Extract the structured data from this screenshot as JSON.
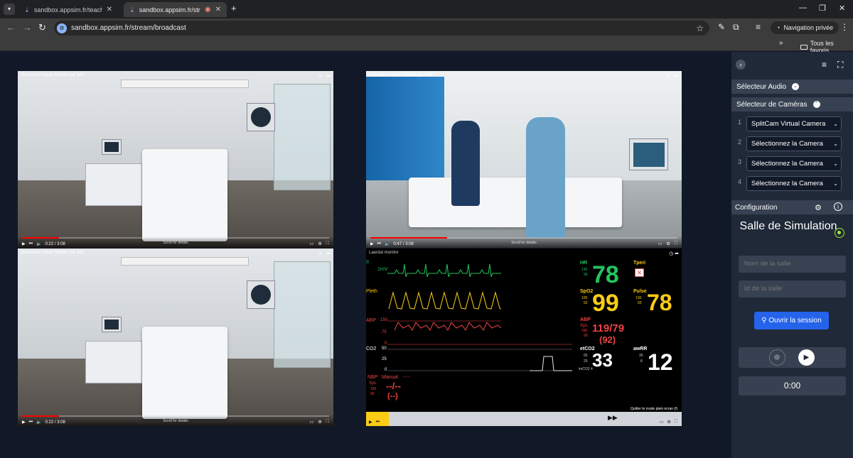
{
  "browser": {
    "tabs": [
      {
        "title": "sandbox.appsim.fr/teacher/tea",
        "active": false
      },
      {
        "title": "sandbox.appsim.fr/stream/b",
        "active": true
      }
    ],
    "url": "sandbox.appsim.fr/stream/broadcast",
    "private_label": "Navigation privée",
    "bookmarks_label": "Tous les favoris"
  },
  "videos": {
    "top_left": {
      "title": "Simulation Haute Fidélité par IMS",
      "time": "0:22 / 3:08",
      "scroll": "Scroll for details"
    },
    "top_right": {
      "title": "Simulation Haute Fidélité par IMS",
      "time": "0:47 / 3:08",
      "scroll": "Scroll for details"
    },
    "bottom_left": {
      "title": "Simulation Haute Fidélité par IMS",
      "time": "0:22 / 3:08",
      "scroll": "Scroll for details"
    },
    "monitor": {
      "title": "Laerdal monitor",
      "exit_fullscreen": "Quitter le mode plein écran (f)",
      "ecg": {
        "label": "II",
        "scale": "1mV"
      },
      "pleth": {
        "label": "Pleth"
      },
      "abp": {
        "label": "ABP",
        "top": "150",
        "mid": "75",
        "low": "0"
      },
      "co2": {
        "label": "CO2",
        "top": "50",
        "mid": "25",
        "low": "0"
      },
      "nbp": {
        "label": "NBP",
        "mode": "Manual",
        "time": "--:--",
        "sys_label": "Sys.",
        "sys_hi": "160",
        "sys_lo": "90",
        "value": "--/--",
        "mean": "(--)"
      },
      "hr": {
        "label": "HR",
        "hi": "130",
        "lo": "90",
        "value": "78"
      },
      "spo2": {
        "label": "SpO2",
        "hi": "100",
        "lo": "92",
        "value": "99"
      },
      "abp_num": {
        "label": "ABP",
        "sys": "Sys.",
        "hi": "160",
        "lo": "90",
        "value": "119/79",
        "mean": "(92)"
      },
      "etco2": {
        "label": "etCO2",
        "hi": "65",
        "lo": "25",
        "value": "33",
        "inco2": "imCO2 4"
      },
      "tperi": {
        "label": "Tperi"
      },
      "pulse": {
        "label": "Pulse",
        "hi": "130",
        "lo": "50",
        "value": "78"
      },
      "awrr": {
        "label": "awRR",
        "hi": "30",
        "lo": "8",
        "value": "12"
      }
    }
  },
  "panel": {
    "audio_selector": "Sélecteur Audio",
    "camera_selector": "Sélecteur de Caméras",
    "cameras": [
      {
        "num": "1",
        "value": "SplitCam Virtual Camera"
      },
      {
        "num": "2",
        "value": "Sélectionnez la Camera"
      },
      {
        "num": "3",
        "value": "Sélectionnez la Camera"
      },
      {
        "num": "4",
        "value": "Sélectionnez la Camera"
      }
    ],
    "configuration": "Configuration",
    "salle_title": "Salle de Simulation",
    "room_name_placeholder": "Nom de la salle",
    "room_id_placeholder": "Id de la salle",
    "open_session": "Ouvrir la session",
    "timer": "0:00"
  },
  "colors": {
    "page_bg": "#111827",
    "panel_bg": "#1f2937",
    "accent_blue": "#2563eb",
    "live_green": "#a3e635",
    "hr_green": "#22c55e",
    "spo2_yellow": "#facc15",
    "abp_red": "#ef4444"
  }
}
